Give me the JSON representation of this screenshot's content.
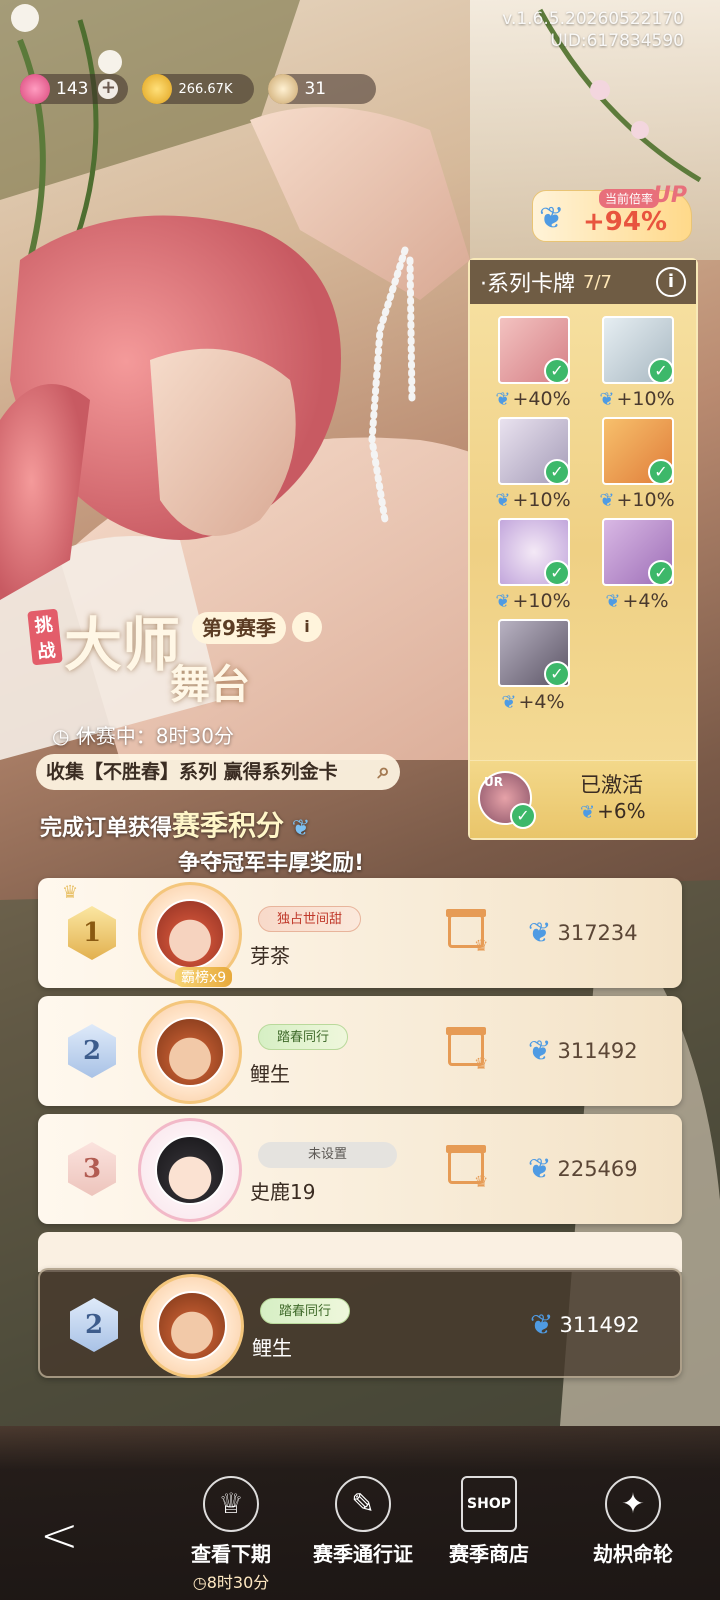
{
  "header": {
    "version": "v.1.6.5.20260522170",
    "uid": "UID:617834590"
  },
  "currency": [
    {
      "icon": "gem-icon",
      "value": "143",
      "color": "#f06a9a",
      "has_plus": true
    },
    {
      "icon": "coin-icon",
      "value": "266.67K",
      "color": "#f2c23a",
      "has_plus": false
    },
    {
      "icon": "star-token-icon",
      "value": "31",
      "color": "#e2c89a",
      "has_plus": false
    }
  ],
  "multiplier": {
    "label": "当前倍率",
    "value": "+94%",
    "up": "UP"
  },
  "series_cards": {
    "title": "·系列卡牌",
    "count": "7/7",
    "cards": [
      {
        "bonus": "+40%",
        "color": "#e9a6a8"
      },
      {
        "bonus": "+10%",
        "color": "#c7d3da"
      },
      {
        "bonus": "+10%",
        "color": "#c9c3d6"
      },
      {
        "bonus": "+10%",
        "color": "#f0a553"
      },
      {
        "bonus": "+10%",
        "color": "#cdb8e0"
      },
      {
        "bonus": "+4%",
        "color": "#c8a6d6"
      },
      {
        "bonus": "+4%",
        "color": "#9c94a8"
      }
    ],
    "activated": {
      "badge": "UR",
      "label": "已激活",
      "bonus": "+6%"
    }
  },
  "event": {
    "tag": "挑战",
    "title_line1": "大师",
    "title_line2": "舞台",
    "season": "第9赛季",
    "break_status": "休赛中：8时30分",
    "collect": "收集【不胜春】系列 赢得系列金卡",
    "slogan_prefix": "完成订单获得",
    "slogan_highlight": "赛季积分",
    "slogan_line2": "争夺冠军丰厚奖励!"
  },
  "ranking": [
    {
      "rank": "1",
      "name": "芽茶",
      "title": "独占世间甜",
      "crown_badge": "霸榜x9",
      "score": "317234"
    },
    {
      "rank": "2",
      "name": "鲤生",
      "title": "踏春同行",
      "crown_badge": "",
      "score": "311492"
    },
    {
      "rank": "3",
      "name": "史鹿19",
      "title": "未设置",
      "crown_badge": "",
      "score": "225469"
    }
  ],
  "my_rank": {
    "rank": "2",
    "name": "鲤生",
    "title": "踏春同行",
    "score": "311492"
  },
  "bottom_nav": [
    {
      "icon": "trophy-icon",
      "label": "查看下期",
      "sub": "8时30分"
    },
    {
      "icon": "pass-scroll-icon",
      "label": "赛季通行证",
      "sub": ""
    },
    {
      "icon": "shop-sign-icon",
      "label": "赛季商店",
      "sub": "",
      "sign": "SHOP"
    },
    {
      "icon": "compass-wheel-icon",
      "label": "劫枳命轮",
      "sub": ""
    }
  ]
}
